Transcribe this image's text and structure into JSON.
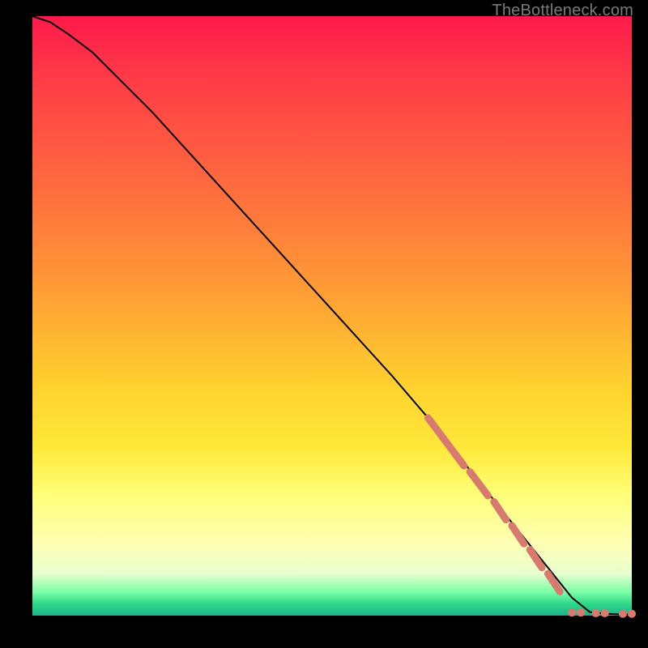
{
  "attribution": "TheBottleneck.com",
  "chart_data": {
    "type": "line",
    "title": "",
    "xlabel": "",
    "ylabel": "",
    "xlim": [
      0,
      100
    ],
    "ylim": [
      0,
      100
    ],
    "grid": false,
    "legend": false,
    "series": [
      {
        "name": "bottleneck-curve",
        "color": "#000000",
        "x": [
          0,
          3,
          6,
          10,
          15,
          20,
          30,
          40,
          50,
          60,
          66,
          70,
          74,
          78,
          82,
          86,
          90,
          93,
          96,
          98,
          100
        ],
        "y": [
          100,
          99,
          97,
          94,
          89,
          84,
          73,
          62,
          51,
          40,
          33,
          28,
          23,
          18,
          13,
          8,
          3,
          0.6,
          0.3,
          0.2,
          0.2
        ]
      }
    ],
    "markers": [
      {
        "name": "highlight-dashes",
        "color": "#d87a70",
        "segments": [
          {
            "x0": 66,
            "y0": 33,
            "x1": 69,
            "y1": 29
          },
          {
            "x0": 69,
            "y0": 29,
            "x1": 72,
            "y1": 25
          },
          {
            "x0": 73,
            "y0": 24,
            "x1": 76,
            "y1": 20
          },
          {
            "x0": 77,
            "y0": 19,
            "x1": 79,
            "y1": 16
          },
          {
            "x0": 80,
            "y0": 15,
            "x1": 82,
            "y1": 12
          },
          {
            "x0": 83,
            "y0": 11,
            "x1": 85,
            "y1": 8
          },
          {
            "x0": 86,
            "y0": 7,
            "x1": 88,
            "y1": 4
          }
        ]
      },
      {
        "name": "highlight-dots",
        "color": "#d87a70",
        "points": [
          {
            "x": 90,
            "y": 0.5
          },
          {
            "x": 91.5,
            "y": 0.5
          },
          {
            "x": 94,
            "y": 0.4
          },
          {
            "x": 95.5,
            "y": 0.4
          },
          {
            "x": 98.5,
            "y": 0.3
          },
          {
            "x": 100,
            "y": 0.3
          }
        ]
      }
    ],
    "background_gradient": {
      "orientation": "vertical",
      "stops": [
        {
          "pos": 0.0,
          "color": "#ff1a4b"
        },
        {
          "pos": 0.28,
          "color": "#ff6a3f"
        },
        {
          "pos": 0.62,
          "color": "#ffd22e"
        },
        {
          "pos": 0.88,
          "color": "#ffffb5"
        },
        {
          "pos": 0.96,
          "color": "#7fffa8"
        },
        {
          "pos": 1.0,
          "color": "#1db38a"
        }
      ]
    }
  }
}
